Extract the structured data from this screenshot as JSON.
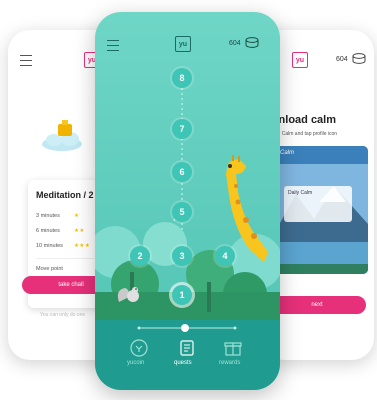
{
  "left_screen": {
    "logo": "yu",
    "card": {
      "title": "Meditation / 2",
      "rows": [
        {
          "label": "3 minutes",
          "stars": "★"
        },
        {
          "label": "6 minutes",
          "stars": "★★"
        },
        {
          "label": "10 minutes",
          "stars": "★★★"
        }
      ],
      "move_point": "Move point",
      "button_label": "take chall"
    },
    "footnote": "You can only do one"
  },
  "center_screen": {
    "logo": "yu",
    "points": "604",
    "quest_nodes": [
      "8",
      "7",
      "6",
      "5",
      "4",
      "3",
      "2",
      "1"
    ],
    "nav": {
      "items": [
        {
          "label": "yucoin"
        },
        {
          "label": "quests"
        },
        {
          "label": "rewards"
        }
      ]
    }
  },
  "right_screen": {
    "logo": "yu",
    "points": "604",
    "title": "wnload calm",
    "subtitle": "oad Calm and tap profile icon",
    "app_name": "Calm",
    "daily_calm": "Daily Calm",
    "button_label": "next"
  },
  "colors": {
    "accent": "#e6307a",
    "teal": "#5fcfc0",
    "teal_dark": "#1f9c8f",
    "giraffe": "#f7c51e"
  }
}
